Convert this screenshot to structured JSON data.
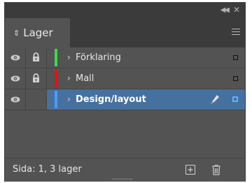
{
  "panel": {
    "tab_label": "Lager",
    "tab_icon": "up-down-arrows-icon",
    "collapse_icon": "double-chevron-left-icon",
    "close_icon": "close-icon",
    "menu_icon": "hamburger-menu-icon"
  },
  "layers": [
    {
      "name": "Förklaring",
      "visible": true,
      "locked": true,
      "color": "#3adc47",
      "selected": false
    },
    {
      "name": "Mall",
      "visible": true,
      "locked": true,
      "color": "#e01414",
      "selected": false
    },
    {
      "name": "Design/layout",
      "visible": true,
      "locked": false,
      "color": "#4a9cff",
      "selected": true
    }
  ],
  "footer": {
    "status_text": "Sida: 1, 3 lager",
    "new_layer_icon": "new-layer-icon",
    "trash_icon": "trash-icon"
  },
  "colors": {
    "panel_bg": "#535353",
    "header_bg": "#3b3b3b",
    "selected_row": "#46709e"
  }
}
